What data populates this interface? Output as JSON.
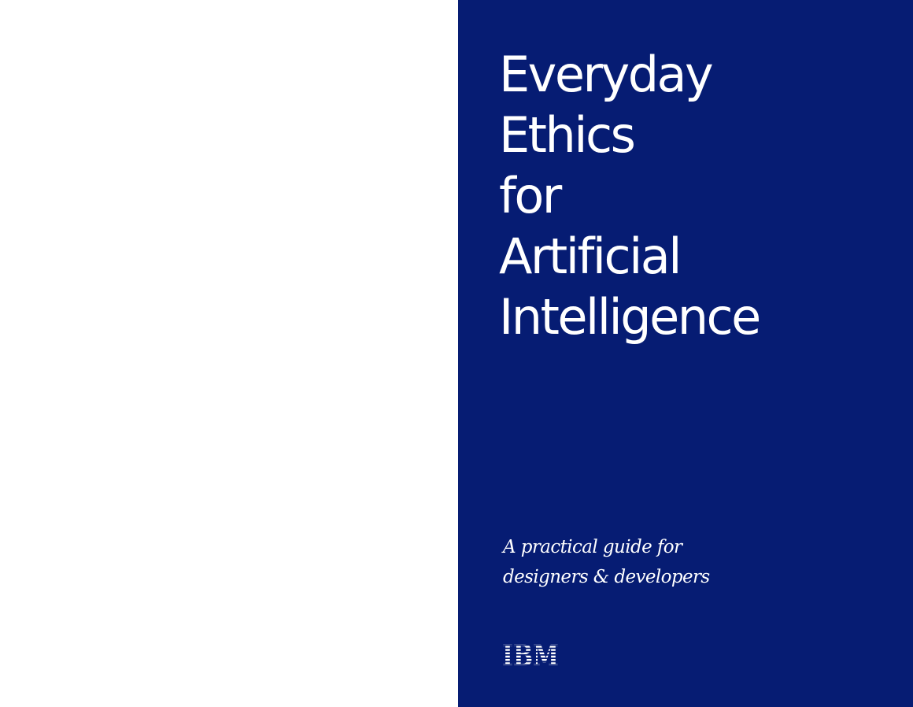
{
  "cover": {
    "title_lines": [
      "Everyday",
      "Ethics",
      "for",
      "Artificial",
      "Intelligence"
    ],
    "subtitle_lines": [
      "A practical guide for",
      "designers & developers"
    ],
    "logo_text": "IBM",
    "background_color": "#061c73",
    "text_color": "#ffffff"
  }
}
